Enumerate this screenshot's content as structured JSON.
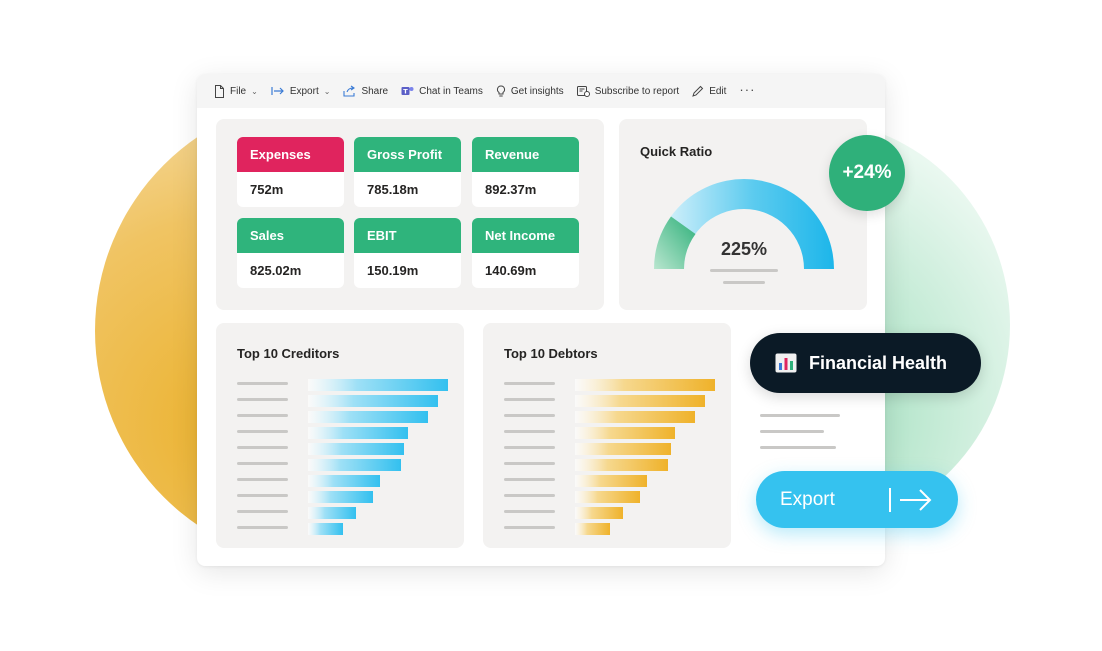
{
  "toolbar": {
    "file": "File",
    "export": "Export",
    "share": "Share",
    "chat": "Chat in Teams",
    "insights": "Get insights",
    "subscribe": "Subscribe to report",
    "edit": "Edit",
    "more": "···"
  },
  "kpis": [
    {
      "label": "Expenses",
      "value": "752m",
      "color": "#e0245e"
    },
    {
      "label": "Gross Profit",
      "value": "785.18m",
      "color": "#2fb47c"
    },
    {
      "label": "Revenue",
      "value": "892.37m",
      "color": "#2fb47c"
    },
    {
      "label": "Sales",
      "value": "825.02m",
      "color": "#2fb47c"
    },
    {
      "label": "EBIT",
      "value": "150.19m",
      "color": "#2fb47c"
    },
    {
      "label": "Net Income",
      "value": "140.69m",
      "color": "#2fb47c"
    }
  ],
  "quick_ratio": {
    "title": "Quick Ratio",
    "value": "225%",
    "badge": "+24%"
  },
  "creditors": {
    "title": "Top 10 Creditors",
    "color": "#38c1ef"
  },
  "debtors": {
    "title": "Top 10 Debtors",
    "color": "#efb32c"
  },
  "financial_health": {
    "label": "Financial Health",
    "icon": "bar-chart-icon"
  },
  "export_button": {
    "label": "Export",
    "icon": "arrow-right-icon"
  },
  "colors": {
    "panel_bg": "#f3f2f1",
    "accent_green": "#2fb07a",
    "accent_blue": "#35c2ef",
    "dark": "#0b1a26"
  }
}
